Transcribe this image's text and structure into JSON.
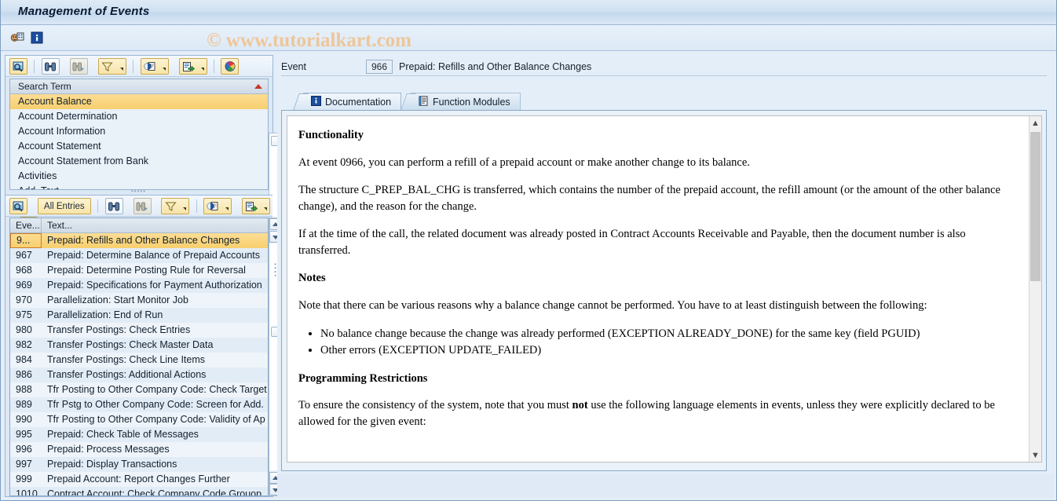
{
  "window": {
    "title": "Management of Events"
  },
  "watermark": "© www.tutorialkart.com",
  "top_toolbar": {
    "buttons": [
      {
        "name": "customizing-icon",
        "tooltip": "Customizing"
      },
      {
        "name": "information-icon",
        "tooltip": "Information"
      }
    ]
  },
  "left_panel": {
    "search_toolbar": {
      "find_label": "",
      "buttons": [
        {
          "name": "find-magnifier-icon"
        },
        {
          "name": "find-binoculars-icon"
        },
        {
          "name": "find-next-icon"
        },
        {
          "name": "filter-icon"
        },
        {
          "name": "print-preview-icon"
        },
        {
          "name": "export-icon"
        },
        {
          "name": "layout-colors-icon"
        }
      ]
    },
    "search_term_list": {
      "header": "Search Term",
      "items": [
        "Account Balance",
        "Account Determination",
        "Account Information",
        "Account Statement",
        "Account Statement from Bank",
        "Activities",
        "Add. Text"
      ],
      "selected_index": 0
    },
    "events_toolbar": {
      "all_entries_label": "All Entries",
      "buttons": [
        {
          "name": "find-magnifier-icon"
        },
        {
          "name": "find-binoculars-icon"
        },
        {
          "name": "find-next-icon"
        },
        {
          "name": "filter-icon"
        },
        {
          "name": "print-preview-icon"
        },
        {
          "name": "export-icon"
        },
        {
          "name": "layout-colors-icon"
        }
      ]
    },
    "events_table": {
      "columns": [
        "Eve...",
        "Text..."
      ],
      "rows": [
        {
          "event": "9...",
          "text": "Prepaid: Refills and Other Balance Changes"
        },
        {
          "event": "967",
          "text": "Prepaid: Determine Balance of Prepaid Accounts"
        },
        {
          "event": "968",
          "text": "Prepaid: Determine Posting Rule for Reversal"
        },
        {
          "event": "969",
          "text": "Prepaid: Specifications for Payment Authorization"
        },
        {
          "event": "970",
          "text": "Parallelization: Start Monitor Job"
        },
        {
          "event": "975",
          "text": "Parallelization: End of Run"
        },
        {
          "event": "980",
          "text": "Transfer Postings: Check Entries"
        },
        {
          "event": "982",
          "text": "Transfer Postings: Check Master Data"
        },
        {
          "event": "984",
          "text": "Transfer Postings: Check Line Items"
        },
        {
          "event": "986",
          "text": "Transfer Postings: Additional Actions"
        },
        {
          "event": "988",
          "text": "Tfr Posting to Other Company Code: Check Target"
        },
        {
          "event": "989",
          "text": "Tfr Pstg to Other Company Code: Screen for Add."
        },
        {
          "event": "990",
          "text": "Tfr Posting to Other Company Code: Validity of Ap"
        },
        {
          "event": "995",
          "text": "Prepaid: Check Table of Messages"
        },
        {
          "event": "996",
          "text": "Prepaid: Process Messages"
        },
        {
          "event": "997",
          "text": "Prepaid: Display Transactions"
        },
        {
          "event": "999",
          "text": "Prepaid Account: Report Changes Further"
        },
        {
          "event": "1010",
          "text": "Contract Account: Check Company Code Grouop"
        }
      ],
      "selected_index": 0
    }
  },
  "right_panel": {
    "event_label": "Event",
    "event_number": "966",
    "event_title": "Prepaid: Refills and Other Balance Changes",
    "tabs": [
      {
        "label": "Documentation",
        "icon": "information-icon",
        "active": true
      },
      {
        "label": "Function Modules",
        "icon": "document-list-icon",
        "active": false
      }
    ],
    "documentation": {
      "heading_functionality": "Functionality",
      "para_1": "At event 0966, you can perform a refill of a prepaid account or make another change to its balance.",
      "para_2": "The structure C_PREP_BAL_CHG is transferred, which contains the number of the prepaid account, the refill amount (or the amount of the other balance change), and the reason for the change.",
      "para_3": "If at the time of the call, the related document was already posted in Contract Accounts Receivable and Payable, then the document number is also transferred.",
      "heading_notes": "Notes",
      "para_4": "Note that there can be various reasons why a balance change cannot be performed. You have to at least distinguish between the following:",
      "bullets": [
        "No balance change because the change was already performed (EXCEPTION ALREADY_DONE) for the same key (field PGUID)",
        "Other errors (EXCEPTION UPDATE_FAILED)"
      ],
      "heading_restrictions": "Programming Restrictions",
      "para_5_a": "To ensure the consistency of the system, note that you must ",
      "para_5_bold": "not",
      "para_5_b": " use the following language elements in events, unless they were explicitly declared to be allowed for the given event:"
    }
  },
  "colors": {
    "title_bar": "#cfe0f1",
    "panel_bg": "#e4eef8",
    "selection": "#f8cf6e",
    "watermark": "#f1c08a",
    "row_odd": "#eef4fa",
    "row_even": "#e2ecf6"
  }
}
